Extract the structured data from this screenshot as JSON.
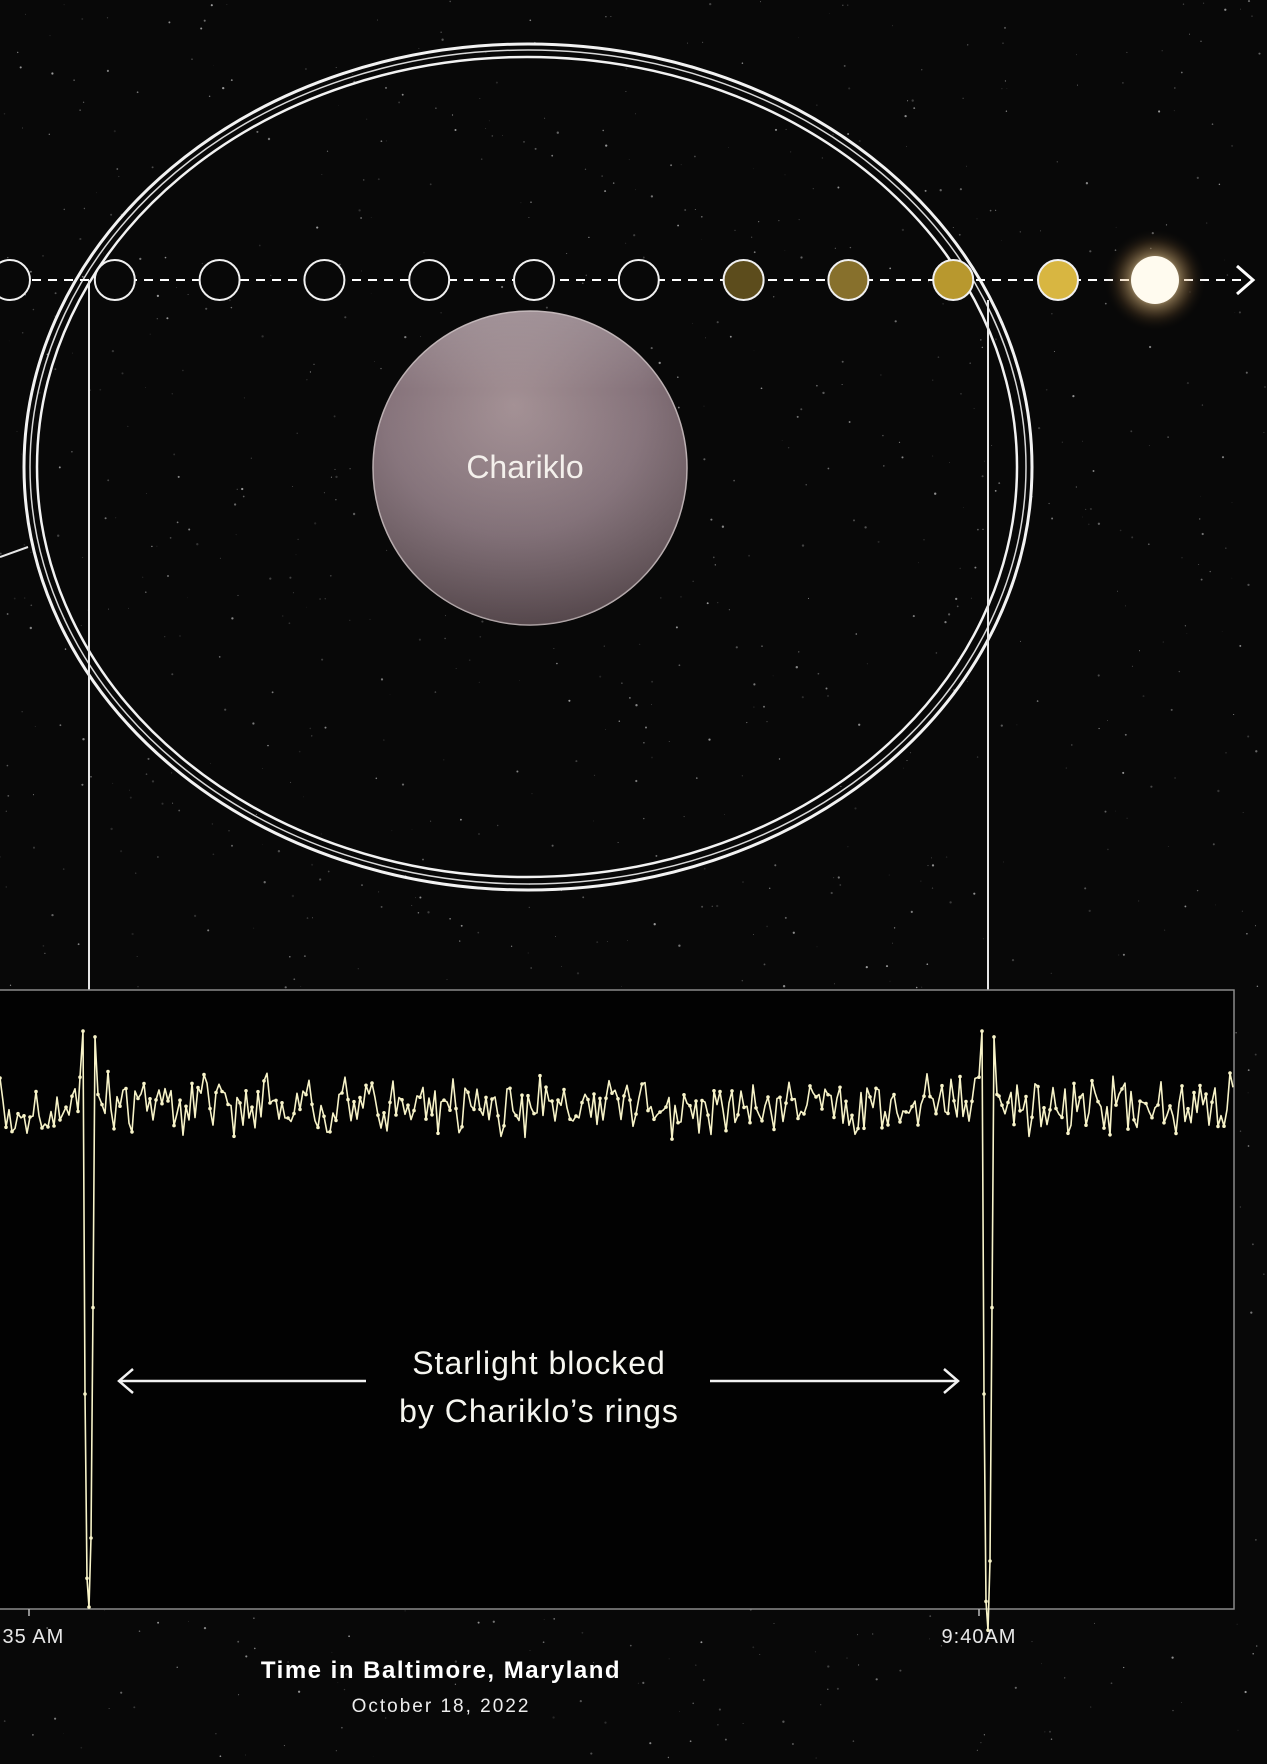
{
  "diagram": {
    "body_label": "Chariklo",
    "colors": {
      "background": "#080808",
      "ring": "#f2f2f2",
      "body_fill": "#7d6a6d",
      "lightcurve": "#f7f3c8",
      "star": "#fff6dc",
      "track": "#ffffff"
    },
    "track_markers": [
      {
        "state": "empty"
      },
      {
        "state": "empty"
      },
      {
        "state": "empty"
      },
      {
        "state": "empty"
      },
      {
        "state": "empty"
      },
      {
        "state": "empty"
      },
      {
        "state": "empty"
      },
      {
        "state": "dim",
        "fill": "#5c4c1c"
      },
      {
        "state": "medium",
        "fill": "#87702c"
      },
      {
        "state": "bright",
        "fill": "#b8982e"
      },
      {
        "state": "brighter",
        "fill": "#d8b641"
      }
    ]
  },
  "chart_data": {
    "type": "line",
    "title": "",
    "xlabel": "Time in Baltimore, Maryland",
    "subtitle": "October 18, 2022",
    "ylabel": "",
    "x_tick_labels": [
      ":35 AM",
      "9:40AM"
    ],
    "annotation": {
      "line1": "Starlight blocked",
      "line2": "by Chariklo’s rings"
    },
    "series": [
      {
        "baseline": 1.0,
        "noise_amplitude": 0.04,
        "dips": [
          {
            "time": "9:35 AM (approx.)",
            "min_relative_flux": 0.13
          },
          {
            "time": "9:40 AM (approx.)",
            "min_relative_flux": 0.09
          }
        ]
      }
    ]
  }
}
